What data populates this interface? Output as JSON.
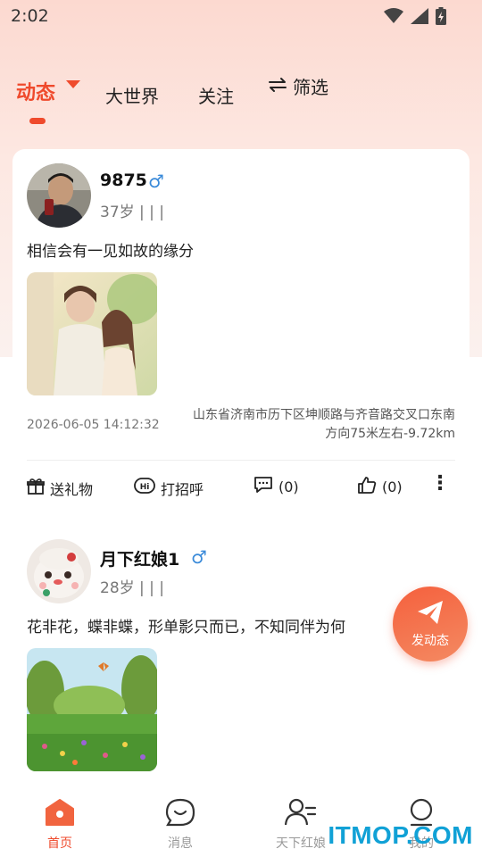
{
  "status_bar": {
    "time": "2:02"
  },
  "tabs": [
    {
      "label": "动态",
      "active": true
    },
    {
      "label": "大世界"
    },
    {
      "label": "关注"
    }
  ],
  "filter": {
    "label": "筛选",
    "icon": "swap-icon"
  },
  "colors": {
    "accent": "#ef4a2c",
    "male": "#3a8ad9"
  },
  "posts": [
    {
      "username": "9875",
      "gender": "♂",
      "meta": "37岁 | | |",
      "text": "相信会有一见如故的缘分",
      "datetime": "2026-06-05 14:12:32",
      "location": "山东省济南市历下区坤顺路与齐音路交叉口东南方向75米左右-9.72km",
      "actions": {
        "gift": "送礼物",
        "greet": "打招呼",
        "comments": "(0)",
        "likes": "(0)"
      }
    },
    {
      "username": "月下红娘1",
      "gender": "♂",
      "meta": "28岁 | | |",
      "text": "花非花，蝶非蝶，形单影只而已，不知同伴为何"
    }
  ],
  "fab": {
    "label": "发动态"
  },
  "bottom_nav": [
    {
      "label": "首页",
      "icon": "home-icon",
      "active": true
    },
    {
      "label": "消息",
      "icon": "chat-icon"
    },
    {
      "label": "天下红娘",
      "icon": "user-list-icon"
    },
    {
      "label": "我的",
      "icon": "profile-icon"
    }
  ],
  "watermark": "ITMOP.COM"
}
